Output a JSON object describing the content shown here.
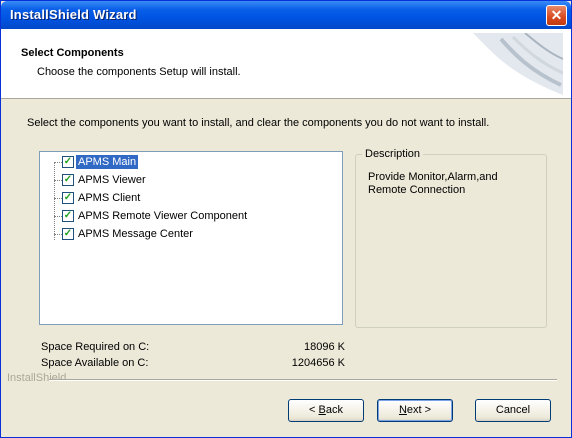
{
  "window": {
    "title": "InstallShield Wizard",
    "close_glyph": "✕"
  },
  "header": {
    "title": "Select Components",
    "subtitle": "Choose the components Setup will install."
  },
  "instruction": "Select the components you want to install, and clear the components you do not want to install.",
  "components": [
    {
      "label": "APMS Main",
      "checked": true,
      "selected": true
    },
    {
      "label": "APMS Viewer",
      "checked": true,
      "selected": false
    },
    {
      "label": "APMS Client",
      "checked": true,
      "selected": false
    },
    {
      "label": "APMS Remote Viewer Component",
      "checked": true,
      "selected": false
    },
    {
      "label": "APMS Message Center",
      "checked": true,
      "selected": false
    }
  ],
  "check_glyph": "✓",
  "description": {
    "legend": "Description",
    "text": "Provide Monitor,Alarm,and Remote Connection"
  },
  "space": {
    "required_label": "Space Required on  C:",
    "required_value": "18096 K",
    "available_label": "Space Available on  C:",
    "available_value": "1204656 K"
  },
  "brand": "InstallShield",
  "buttons": {
    "back_prefix": "< ",
    "back_mnemonic": "B",
    "back_rest": "ack",
    "next_mnemonic": "N",
    "next_rest": "ext >",
    "cancel": "Cancel"
  },
  "colors": {
    "titlebar": "#0054e3",
    "selection": "#316ac5",
    "dialog_bg": "#ece9d8"
  }
}
